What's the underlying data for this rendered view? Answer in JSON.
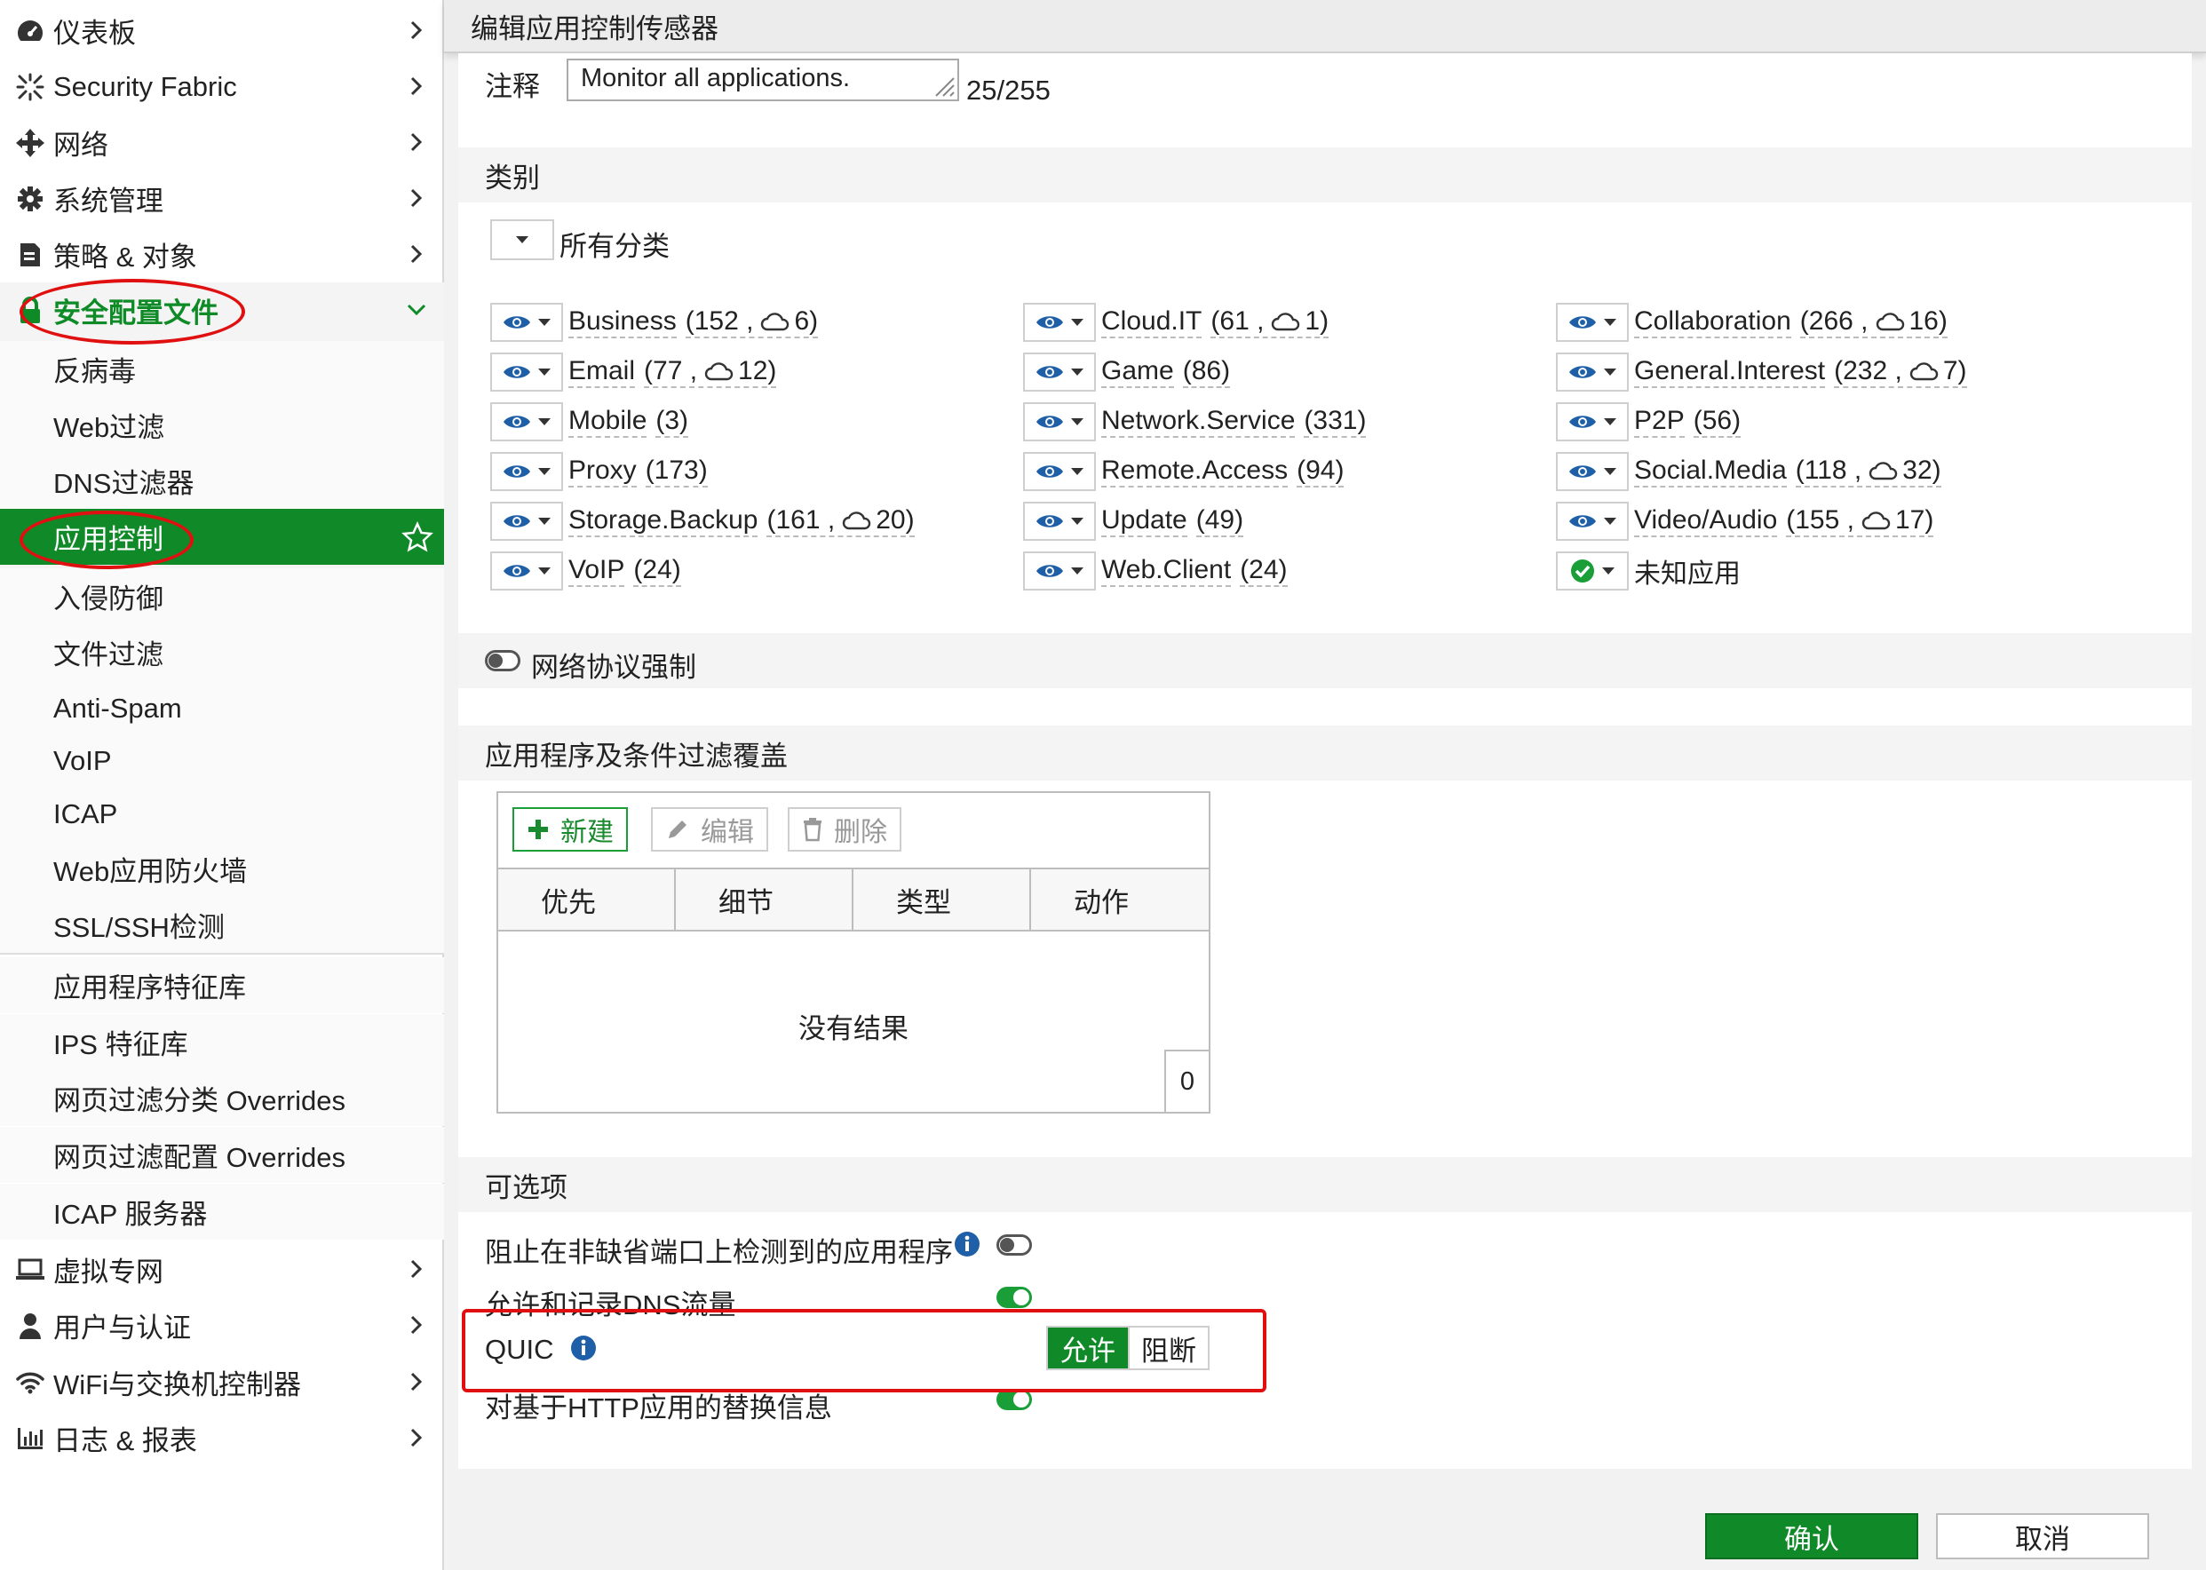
{
  "sidebar": {
    "items": [
      {
        "label": "仪表板",
        "icon": "dashboard-icon"
      },
      {
        "label": "Security Fabric",
        "icon": "fabric-icon"
      },
      {
        "label": "网络",
        "icon": "network-icon"
      },
      {
        "label": "系统管理",
        "icon": "gear-icon"
      },
      {
        "label": "策略 & 对象",
        "icon": "policy-icon"
      },
      {
        "label": "安全配置文件",
        "icon": "lock-icon"
      }
    ],
    "security_sub": [
      "反病毒",
      "Web过滤",
      "DNS过滤器",
      "应用控制",
      "入侵防御",
      "文件过滤",
      "Anti-Spam",
      "VoIP",
      "ICAP",
      "Web应用防火墙",
      "SSL/SSH检测"
    ],
    "security_sub2": [
      "应用程序特征库",
      "IPS 特征库",
      "网页过滤分类 Overrides",
      "网页过滤配置 Overrides",
      "ICAP 服务器"
    ],
    "items_bottom": [
      {
        "label": "虚拟专网",
        "icon": "laptop-icon"
      },
      {
        "label": "用户与认证",
        "icon": "user-icon"
      },
      {
        "label": "WiFi与交换机控制器",
        "icon": "wifi-icon"
      },
      {
        "label": "日志 & 报表",
        "icon": "chart-icon"
      }
    ]
  },
  "panel": {
    "title": "编辑应用控制传感器",
    "comment_label": "注释",
    "comment_value": "Monitor all applications.",
    "comment_count": "25/255",
    "category_header": "类别",
    "all_categories": "所有分类",
    "categories": [
      {
        "name": "Business",
        "count": "(152 ,",
        "cloud": "6)",
        "has_cloud": true
      },
      {
        "name": "Cloud.IT",
        "count": "(61 ,",
        "cloud": "1)",
        "has_cloud": true
      },
      {
        "name": "Collaboration",
        "count": "(266 ,",
        "cloud": "16)",
        "has_cloud": true
      },
      {
        "name": "Email",
        "count": "(77 ,",
        "cloud": "12)",
        "has_cloud": true
      },
      {
        "name": "Game",
        "count": "(86)",
        "cloud": "",
        "has_cloud": false
      },
      {
        "name": "General.Interest",
        "count": "(232 ,",
        "cloud": "7)",
        "has_cloud": true
      },
      {
        "name": "Mobile",
        "count": "(3)",
        "cloud": "",
        "has_cloud": false
      },
      {
        "name": "Network.Service",
        "count": "(331)",
        "cloud": "",
        "has_cloud": false
      },
      {
        "name": "P2P",
        "count": "(56)",
        "cloud": "",
        "has_cloud": false
      },
      {
        "name": "Proxy",
        "count": "(173)",
        "cloud": "",
        "has_cloud": false
      },
      {
        "name": "Remote.Access",
        "count": "(94)",
        "cloud": "",
        "has_cloud": false
      },
      {
        "name": "Social.Media",
        "count": "(118 ,",
        "cloud": "32)",
        "has_cloud": true
      },
      {
        "name": "Storage.Backup",
        "count": "(161 ,",
        "cloud": "20)",
        "has_cloud": true
      },
      {
        "name": "Update",
        "count": "(49)",
        "cloud": "",
        "has_cloud": false
      },
      {
        "name": "Video/Audio",
        "count": "(155 ,",
        "cloud": "17)",
        "has_cloud": true
      },
      {
        "name": "VoIP",
        "count": "(24)",
        "cloud": "",
        "has_cloud": false
      },
      {
        "name": "Web.Client",
        "count": "(24)",
        "cloud": "",
        "has_cloud": false
      },
      {
        "name": "未知应用",
        "count": "",
        "cloud": "",
        "has_cloud": false
      }
    ],
    "protocol_enforce": "网络协议强制",
    "override_header": "应用程序及条件过滤覆盖",
    "toolbar": {
      "new": "新建",
      "edit": "编辑",
      "delete": "删除"
    },
    "table_headers": [
      "优先",
      "细节",
      "类型",
      "动作"
    ],
    "no_result": "没有结果",
    "result_count": "0",
    "options_header": "可选项",
    "options": {
      "block_nondefault": "阻止在非缺省端口上检测到的应用程序",
      "allow_dns": "允许和记录DNS流量",
      "quic": "QUIC",
      "quic_allow": "允许",
      "quic_block": "阻断",
      "http_replace": "对基于HTTP应用的替换信息"
    },
    "ok": "确认",
    "cancel": "取消"
  },
  "colors": {
    "accent": "#108a28",
    "highlight": "#e01010"
  }
}
